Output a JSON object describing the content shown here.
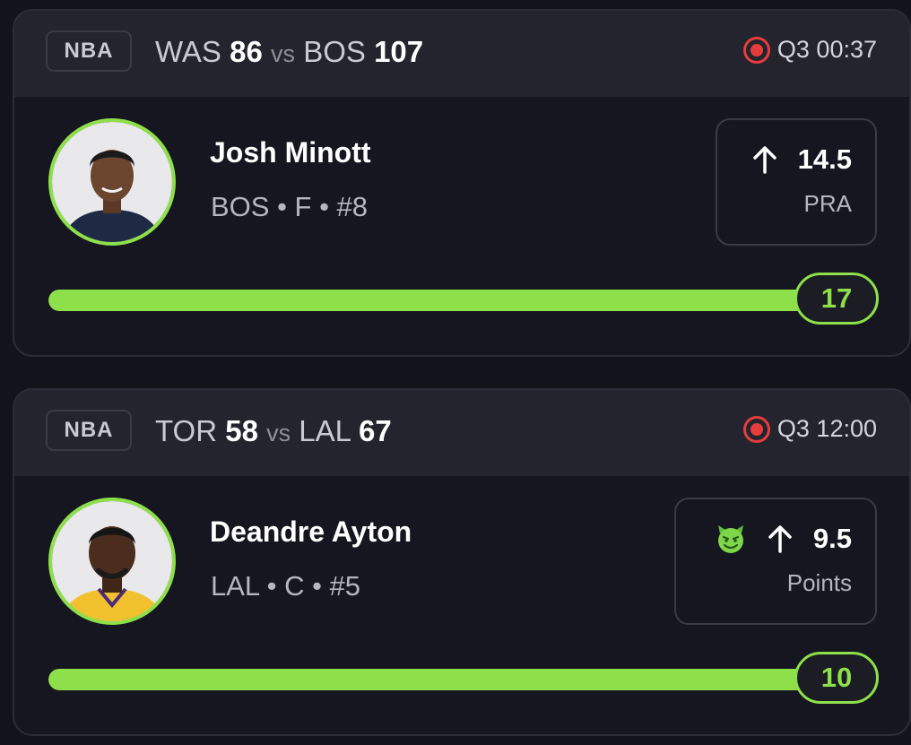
{
  "colors": {
    "accent": "#8ee04a",
    "live": "#e63c3c",
    "background": "#13131c",
    "card_header": "#23242e"
  },
  "cards": [
    {
      "league": "NBA",
      "away_team": "WAS",
      "away_score": "86",
      "vs": "vs",
      "home_team": "BOS",
      "home_score": "107",
      "status": "Q3 00:37",
      "status_icon": "live-record-icon",
      "player": {
        "name": "Josh Minott",
        "info": "BOS • F • #8",
        "avatar_icon": "player-avatar"
      },
      "line": {
        "direction_icon": "arrow-up-icon",
        "value": "14.5",
        "stat": "PRA"
      },
      "progress": {
        "current": "17",
        "percent": 100
      }
    },
    {
      "league": "NBA",
      "away_team": "TOR",
      "away_score": "58",
      "vs": "vs",
      "home_team": "LAL",
      "home_score": "67",
      "status": "Q3 12:00",
      "status_icon": "live-record-icon",
      "player": {
        "name": "Deandre Ayton",
        "info": "LAL • C • #5",
        "avatar_icon": "player-avatar"
      },
      "line": {
        "badge_icon": "devil-emoji-icon",
        "direction_icon": "arrow-up-icon",
        "value": "9.5",
        "stat": "Points"
      },
      "progress": {
        "current": "10",
        "percent": 100
      }
    }
  ]
}
